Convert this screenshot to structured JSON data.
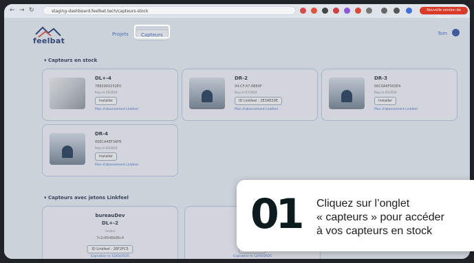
{
  "browser": {
    "url": "staging-dashboard.feelbat.tech/capteurs-stock",
    "profile_label": "Nouvelle version de Chrome"
  },
  "app": {
    "logo_text": "feelbat",
    "tabs": [
      {
        "label": "Projets",
        "active": false
      },
      {
        "label": "Capteurs",
        "active": true
      }
    ],
    "user": "Tom"
  },
  "sections": {
    "stock_title": "Capteurs en stock",
    "jetons_title": "Capteurs avec jetons Linkfeel"
  },
  "stock_cards": [
    {
      "name": "DL+-4",
      "serial": "7882900252E0",
      "sub": "Reçu le 05/2024",
      "button": "Installer",
      "link": "Plan d'abonnement Linkfeel",
      "image": "plug-device"
    },
    {
      "name": "DR-2",
      "serial": "04:CF:A7:6BE4F",
      "sub": "Reçu le 07/2024",
      "button": "ID Linkfeel : 2E3AE20E",
      "link": "Plan d'abonnement Linkfeel",
      "image": "box-device"
    },
    {
      "name": "DR-3",
      "serial": "00C0A6F002E4",
      "sub": "Reçu le 05/2024",
      "button": "Installer",
      "link": "Plan d'abonnement Linkfeel",
      "image": "box-device"
    },
    {
      "name": "DR-4",
      "serial": "00ECA4EF3AF8",
      "sub": "Reçu le 05/2024",
      "button": "Installer",
      "link": "Plan d'abonnement Linkfeel",
      "image": "box-device"
    }
  ],
  "jeton_cards": [
    {
      "title": "bureauDev",
      "name": "DL+-2",
      "muted": "Feelbat",
      "serial": "7c2c8546b86c4",
      "button": "ID Linkfeel : 2EF2FC5",
      "link": "Expiration le 12/03/2025"
    },
    {
      "title": "",
      "name": "",
      "muted": "",
      "serial": "",
      "button": "ID Linkfeel",
      "link": "Expiration le 12/03/2025"
    }
  ],
  "tutorial": {
    "step_number": "01",
    "text_line1": "Cliquez sur l’onglet",
    "text_line2": "« capteurs » pour accéder",
    "text_line3": "à vos capteurs en stock"
  },
  "colors": {
    "accent": "#3d63c9",
    "brand_dark": "#1b2f70",
    "card_border": "#b9c6e0",
    "background": "#eef2f8"
  }
}
